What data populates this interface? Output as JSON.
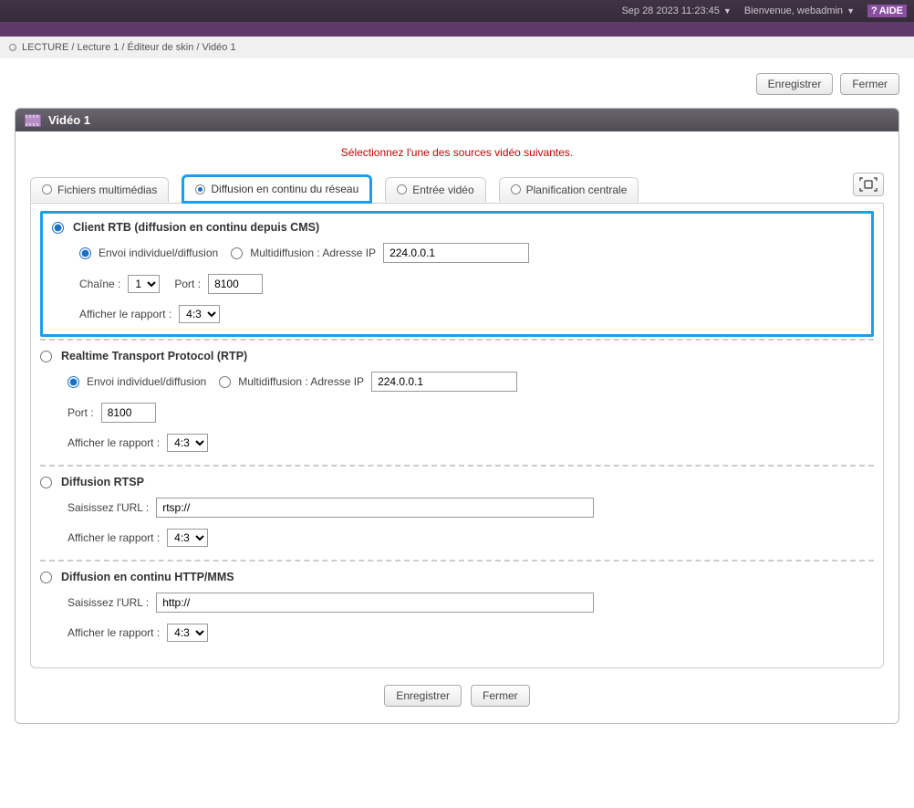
{
  "topbar": {
    "datetime": "Sep 28 2023 11:23:45",
    "welcome": "Bienvenue, webadmin",
    "help": "AIDE"
  },
  "breadcrumb": "LECTURE / Lecture 1 / Éditeur de skin / Vidéo 1",
  "buttons": {
    "save": "Enregistrer",
    "close": "Fermer"
  },
  "panel": {
    "title": "Vidéo 1"
  },
  "instruction": "Sélectionnez l'une des sources vidéo suivantes.",
  "tabs": {
    "media": "Fichiers multimédias",
    "network": "Diffusion en continu du réseau",
    "input": "Entrée vidéo",
    "schedule": "Planification centrale"
  },
  "labels": {
    "uni_broadcast": "Envoi individuel/diffusion",
    "multicast_ip": "Multidiffusion : Adresse IP",
    "channel": "Chaîne :",
    "port": "Port :",
    "aspect": "Afficher le rapport :",
    "enter_url": "Saisissez l'URL :"
  },
  "sections": {
    "rtb": {
      "title": "Client RTB (diffusion en continu depuis CMS)",
      "ip": "224.0.0.1",
      "channel": "1",
      "port": "8100",
      "aspect": "4:3"
    },
    "rtp": {
      "title": "Realtime Transport Protocol (RTP)",
      "ip": "224.0.0.1",
      "port": "8100",
      "aspect": "4:3"
    },
    "rtsp": {
      "title": "Diffusion RTSP",
      "url": "rtsp://",
      "aspect": "4:3"
    },
    "http": {
      "title": "Diffusion en continu HTTP/MMS",
      "url": "http://",
      "aspect": "4:3"
    }
  }
}
